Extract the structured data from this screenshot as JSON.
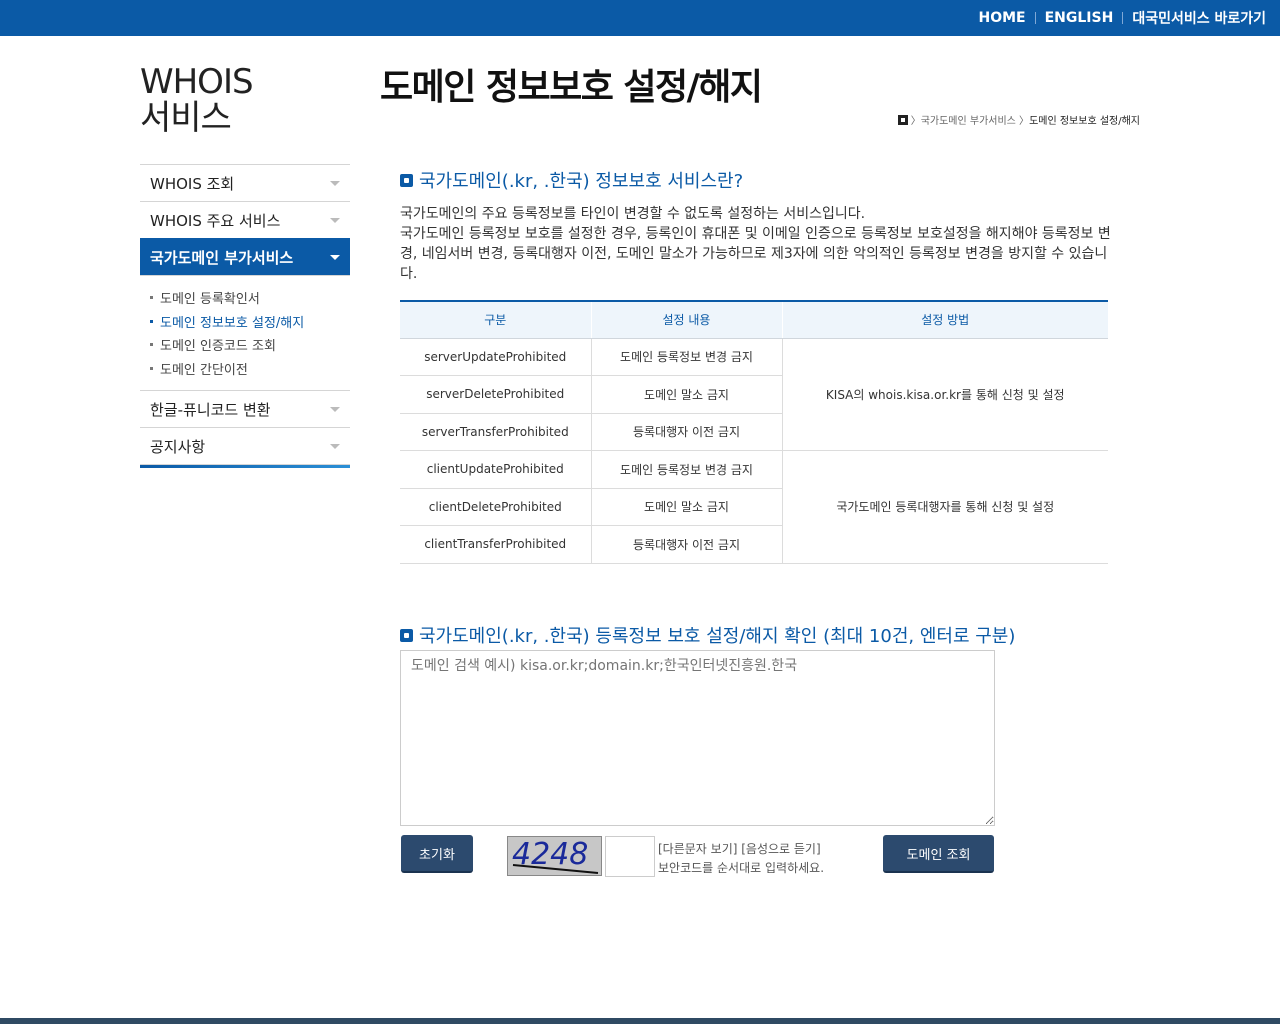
{
  "topbar": {
    "home": "HOME",
    "english": "ENGLISH",
    "korea_service": "대국민서비스 바로가기"
  },
  "sidebar": {
    "title_line1": "WHOIS",
    "title_line2": "서비스",
    "items": [
      {
        "label": "WHOIS 조회"
      },
      {
        "label": "WHOIS 주요 서비스"
      },
      {
        "label": "국가도메인 부가서비스"
      },
      {
        "label": "한글-퓨니코드 변환"
      },
      {
        "label": "공지사항"
      }
    ],
    "subitems": [
      {
        "label": "도메인 등록확인서"
      },
      {
        "label": "도메인 정보보호 설정/해지"
      },
      {
        "label": "도메인 인증코드 조회"
      },
      {
        "label": "도메인 간단이전"
      }
    ]
  },
  "page": {
    "title": "도메인 정보보호 설정/해지",
    "breadcrumb_parent": "〉국가도메인 부가서비스 〉",
    "breadcrumb_current": "도메인 정보보호 설정/해지"
  },
  "section1": {
    "heading": "국가도메인(.kr, .한국) 정보보호 서비스란?",
    "desc_line1": "국가도메인의 주요 등록정보를 타인이 변경할 수 없도록 설정하는 서비스입니다.",
    "desc_line2": "국가도메인 등록정보 보호를 설정한 경우, 등록인이 휴대폰 및 이메일 인증으로 등록정보 보호설정을 해지해야 등록정보 변경, 네임서버 변경, 등록대행자 이전, 도메인 말소가 가능하므로 제3자에 의한 악의적인 등록정보 변경을 방지할 수 있습니다."
  },
  "table": {
    "headers": [
      "구분",
      "설정 내용",
      "설정 방법"
    ],
    "rows": [
      {
        "code": "serverUpdateProhibited",
        "desc": "도메인 등록정보 변경 금지"
      },
      {
        "code": "serverDeleteProhibited",
        "desc": "도메인 말소 금지"
      },
      {
        "code": "serverTransferProhibited",
        "desc": "등록대행자 이전 금지"
      },
      {
        "code": "clientUpdateProhibited",
        "desc": "도메인 등록정보 변경 금지"
      },
      {
        "code": "clientDeleteProhibited",
        "desc": "도메인 말소 금지"
      },
      {
        "code": "clientTransferProhibited",
        "desc": "등록대행자 이전 금지"
      }
    ],
    "method_server": "KISA의 whois.kisa.or.kr를 통해 신청 및 설정",
    "method_client": "국가도메인 등록대행자를 통해 신청 및 설정"
  },
  "section2": {
    "heading": "국가도메인(.kr, .한국) 등록정보 보호 설정/해지 확인 (최대 10건, 엔터로 구분)",
    "placeholder": "도메인 검색 예시) kisa.or.kr;domain.kr;한국인터넷진흥원.한국",
    "reset_label": "초기화",
    "captcha_text": "4248",
    "captcha_links": "[다른문자 보기] [음성으로 듣기]",
    "captcha_hint": "보안코드를 순서대로 입력하세요.",
    "search_label": "도메인 조회"
  },
  "colors": {
    "brand": "#0b5aa6",
    "button": "#2c4a6e"
  }
}
